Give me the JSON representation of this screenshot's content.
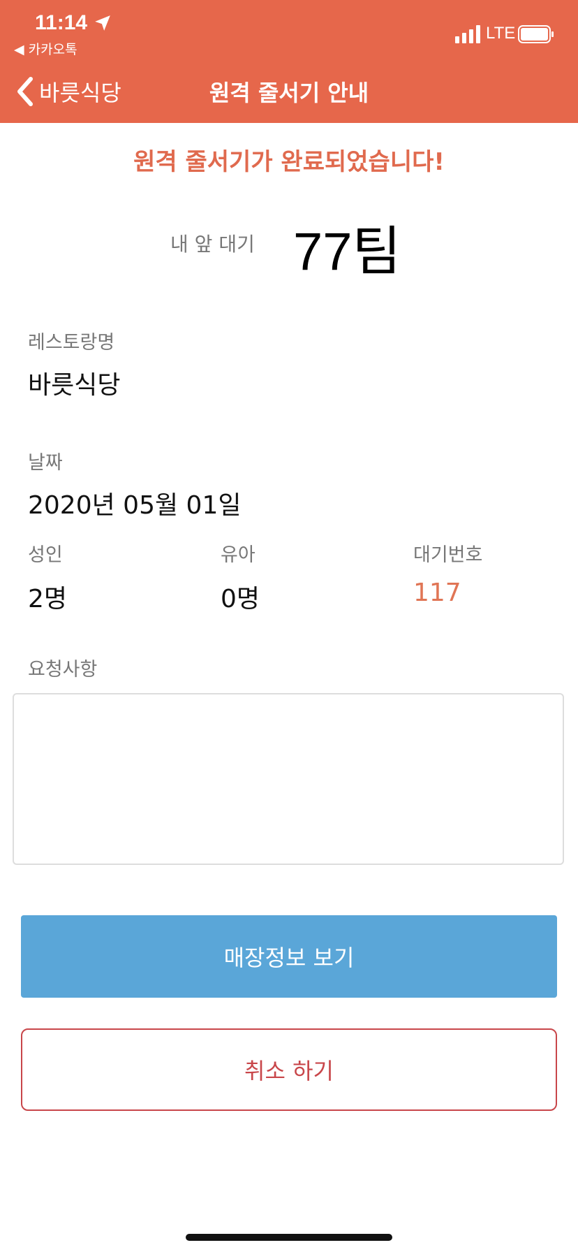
{
  "status_bar": {
    "time": "11:14",
    "back_app": "◀ 카카오톡",
    "network": "LTE"
  },
  "nav": {
    "back_label": "바릇식당",
    "title": "원격 줄서기 안내"
  },
  "main": {
    "success_message": "원격 줄서기가 완료되었습니다!",
    "wait_label": "내 앞 대기",
    "wait_value": "77팀",
    "restaurant_label": "레스토랑명",
    "restaurant_value": "바릇식당",
    "date_label": "날짜",
    "date_value": "2020년 05월 01일",
    "adult_label": "성인",
    "adult_value": "2명",
    "child_label": "유아",
    "child_value": "0명",
    "queue_label": "대기번호",
    "queue_value": "117",
    "request_label": "요청사항",
    "request_value": ""
  },
  "buttons": {
    "store_info": "매장정보 보기",
    "cancel": "취소 하기"
  },
  "colors": {
    "header": "#e6674b",
    "accent": "#e07555",
    "primary_button": "#5aa6d8",
    "cancel": "#c8464a"
  }
}
